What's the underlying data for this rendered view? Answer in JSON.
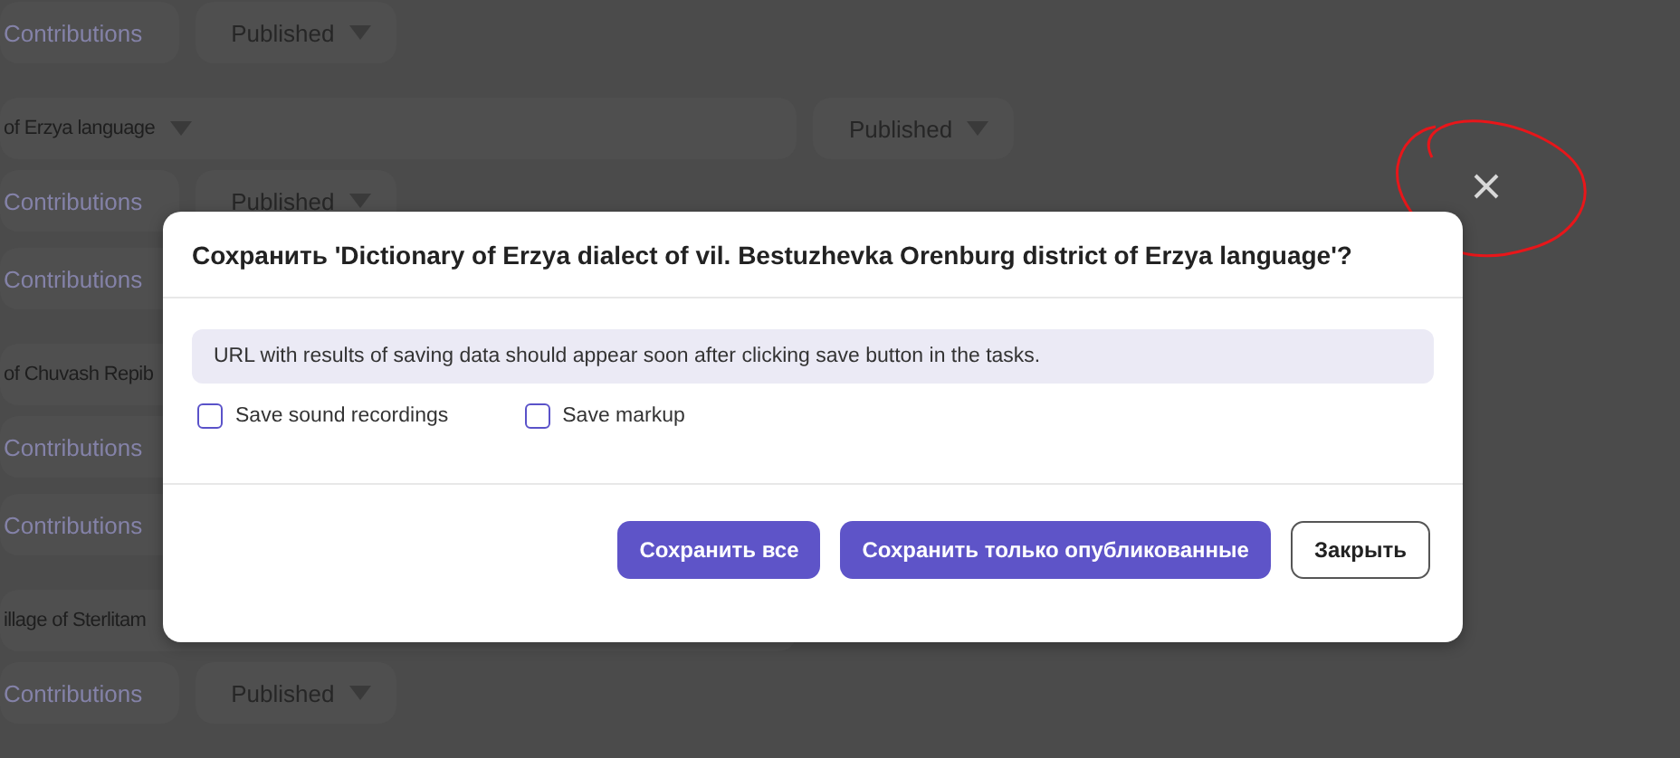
{
  "background": {
    "rows": [
      {
        "kind": "task",
        "contributions": "Contributions",
        "status": "Published"
      },
      {
        "kind": "dictionary",
        "title": "of Erzya language",
        "caret": true,
        "status": "Published"
      },
      {
        "kind": "task",
        "contributions": "Contributions",
        "status": "Published"
      },
      {
        "kind": "task",
        "contributions": "Contributions"
      },
      {
        "kind": "dictionary",
        "title": "of Chuvash Repib"
      },
      {
        "kind": "task",
        "contributions": "Contributions"
      },
      {
        "kind": "task",
        "contributions": "Contributions"
      },
      {
        "kind": "dictionary",
        "title": "illage of Sterlitam"
      },
      {
        "kind": "task",
        "contributions": "Contributions",
        "status": "Published"
      }
    ]
  },
  "dialog": {
    "title": "Сохранить 'Dictionary of Erzya dialect of vil. Bestuzhevka Orenburg district of Erzya language'?",
    "info": "URL with results of saving data should appear soon after clicking save button in the tasks.",
    "checkboxes": [
      {
        "label": "Save sound recordings",
        "checked": false
      },
      {
        "label": "Save markup",
        "checked": false
      }
    ],
    "buttons": [
      {
        "label": "Сохранить все",
        "kind": "primary"
      },
      {
        "label": "Сохранить только опубликованные",
        "kind": "primary"
      },
      {
        "label": "Закрыть",
        "kind": "secondary"
      }
    ]
  }
}
